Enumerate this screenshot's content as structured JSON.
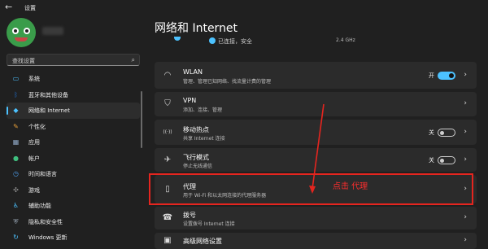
{
  "window": {
    "title": "设置",
    "back_glyph": "←"
  },
  "search": {
    "placeholder": "查找设置",
    "icon": "search-icon"
  },
  "nav": {
    "items": [
      {
        "label": "系统",
        "icon": "monitor-icon",
        "color": "#4cc2ff",
        "glyph": "▭"
      },
      {
        "label": "蓝牙和其他设备",
        "icon": "bluetooth-icon",
        "color": "#1f6fd1",
        "glyph": "ᛒ"
      },
      {
        "label": "网络和 Internet",
        "icon": "wifi-icon",
        "color": "#4cc2ff",
        "glyph": "◆"
      },
      {
        "label": "个性化",
        "icon": "brush-icon",
        "color": "#e8a03a",
        "glyph": "✎"
      },
      {
        "label": "应用",
        "icon": "apps-icon",
        "color": "#8fa7c4",
        "glyph": "▦"
      },
      {
        "label": "帐户",
        "icon": "account-icon",
        "color": "#3fbf7f",
        "glyph": "●"
      },
      {
        "label": "时间和语言",
        "icon": "globe-clock-icon",
        "color": "#4c9be8",
        "glyph": "◷"
      },
      {
        "label": "游戏",
        "icon": "gamepad-icon",
        "color": "#9a9a9a",
        "glyph": "✣"
      },
      {
        "label": "辅助功能",
        "icon": "accessibility-icon",
        "color": "#4cc2ff",
        "glyph": "♿"
      },
      {
        "label": "隐私和安全性",
        "icon": "shield-icon",
        "color": "#9aa7b5",
        "glyph": "⛨"
      },
      {
        "label": "Windows 更新",
        "icon": "update-icon",
        "color": "#4cc2ff",
        "glyph": "↻"
      }
    ],
    "active_index": 2
  },
  "main": {
    "title": "网络和 Internet",
    "connection_status": "已连接，安全",
    "band": "2.4 GHz",
    "rows": [
      {
        "title": "WLAN",
        "subtitle": "管理、管理已知网络、找流量计费的管理",
        "icon": "wifi-icon",
        "glyph": "◠",
        "toggle": "on",
        "toggle_label": "开"
      },
      {
        "title": "VPN",
        "subtitle": "添加、连接、管理",
        "icon": "vpn-shield-icon",
        "glyph": "⛉"
      },
      {
        "title": "移动热点",
        "subtitle": "共享 Internet 连接",
        "icon": "hotspot-icon",
        "glyph": "((·))",
        "toggle": "off",
        "toggle_label": "关"
      },
      {
        "title": "飞行模式",
        "subtitle": "停止无线通信",
        "icon": "airplane-icon",
        "glyph": "✈",
        "toggle": "off",
        "toggle_label": "关"
      },
      {
        "title": "代理",
        "subtitle": "用于 Wi-Fi 和以太网连接的代理服务器",
        "icon": "proxy-server-icon",
        "glyph": "▯"
      },
      {
        "title": "拨号",
        "subtitle": "设置拨号 Internet 连接",
        "icon": "dialup-icon",
        "glyph": "☎"
      },
      {
        "title": "高级网络设置",
        "subtitle": "",
        "icon": "network-adapter-icon",
        "glyph": "▣"
      }
    ],
    "chevron": "›"
  },
  "annotation": {
    "text": "点击 代理",
    "color": "#ff2d2d"
  }
}
